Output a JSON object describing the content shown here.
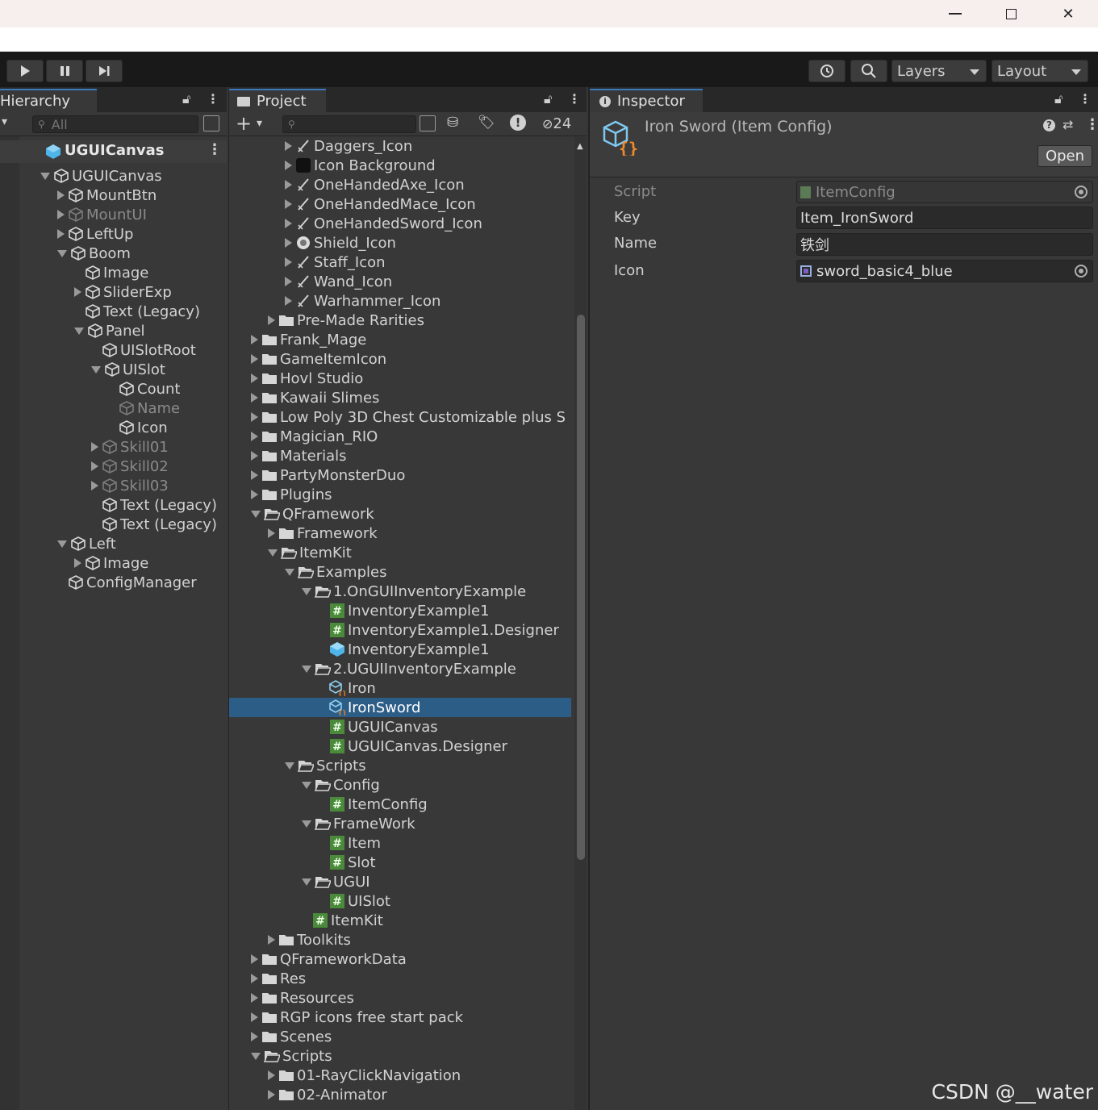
{
  "window": {
    "minimize_icon": "minimize-icon",
    "restore_icon": "restore-icon",
    "close_icon": "close-icon"
  },
  "toolbar": {
    "layers_label": "Layers",
    "layout_label": "Layout"
  },
  "hierarchy": {
    "tab_label": "Hierarchy",
    "search_placeholder": "All",
    "scene_name": "UGUICanvas",
    "items": [
      {
        "label": "UGUICanvas",
        "indent": 0,
        "arrow": "down",
        "dim": false
      },
      {
        "label": "MountBtn",
        "indent": 1,
        "arrow": "right",
        "dim": false
      },
      {
        "label": "MountUI",
        "indent": 1,
        "arrow": "right",
        "dim": true
      },
      {
        "label": "LeftUp",
        "indent": 1,
        "arrow": "right",
        "dim": false
      },
      {
        "label": "Boom",
        "indent": 1,
        "arrow": "down",
        "dim": false
      },
      {
        "label": "Image",
        "indent": 2,
        "arrow": "none",
        "dim": false
      },
      {
        "label": "SliderExp",
        "indent": 2,
        "arrow": "right",
        "dim": false
      },
      {
        "label": "Text (Legacy)",
        "indent": 2,
        "arrow": "none",
        "dim": false
      },
      {
        "label": "Panel",
        "indent": 2,
        "arrow": "down",
        "dim": false
      },
      {
        "label": "UISlotRoot",
        "indent": 3,
        "arrow": "none",
        "dim": false
      },
      {
        "label": "UISlot",
        "indent": 3,
        "arrow": "down",
        "dim": false
      },
      {
        "label": "Count",
        "indent": 4,
        "arrow": "none",
        "dim": false
      },
      {
        "label": "Name",
        "indent": 4,
        "arrow": "none",
        "dim": true
      },
      {
        "label": "Icon",
        "indent": 4,
        "arrow": "none",
        "dim": false
      },
      {
        "label": "Skill01",
        "indent": 3,
        "arrow": "right",
        "dim": true
      },
      {
        "label": "Skill02",
        "indent": 3,
        "arrow": "right",
        "dim": true
      },
      {
        "label": "Skill03",
        "indent": 3,
        "arrow": "right",
        "dim": true
      },
      {
        "label": "Text (Legacy)",
        "indent": 3,
        "arrow": "none",
        "dim": false
      },
      {
        "label": "Text (Legacy)",
        "indent": 3,
        "arrow": "none",
        "dim": false
      },
      {
        "label": "Left",
        "indent": 1,
        "arrow": "down",
        "dim": false
      },
      {
        "label": "Image",
        "indent": 2,
        "arrow": "right",
        "dim": false
      },
      {
        "label": "ConfigManager",
        "indent": 1,
        "arrow": "none",
        "dim": false
      }
    ]
  },
  "project": {
    "tab_label": "Project",
    "hidden_count": "24",
    "items": [
      {
        "label": "Daggers_Icon",
        "indent": 3,
        "arrow": "right",
        "icon": "sprite"
      },
      {
        "label": "Icon Background",
        "indent": 3,
        "arrow": "right",
        "icon": "dark-square"
      },
      {
        "label": "OneHandedAxe_Icon",
        "indent": 3,
        "arrow": "right",
        "icon": "sprite"
      },
      {
        "label": "OneHandedMace_Icon",
        "indent": 3,
        "arrow": "right",
        "icon": "sprite"
      },
      {
        "label": "OneHandedSword_Icon",
        "indent": 3,
        "arrow": "right",
        "icon": "sprite"
      },
      {
        "label": "Shield_Icon",
        "indent": 3,
        "arrow": "right",
        "icon": "shield"
      },
      {
        "label": "Staff_Icon",
        "indent": 3,
        "arrow": "right",
        "icon": "sprite"
      },
      {
        "label": "Wand_Icon",
        "indent": 3,
        "arrow": "right",
        "icon": "sprite"
      },
      {
        "label": "Warhammer_Icon",
        "indent": 3,
        "arrow": "right",
        "icon": "sprite"
      },
      {
        "label": "Pre-Made Rarities",
        "indent": 2,
        "arrow": "right",
        "icon": "folder"
      },
      {
        "label": "Frank_Mage",
        "indent": 1,
        "arrow": "right",
        "icon": "folder"
      },
      {
        "label": "GameItemIcon",
        "indent": 1,
        "arrow": "right",
        "icon": "folder"
      },
      {
        "label": "Hovl Studio",
        "indent": 1,
        "arrow": "right",
        "icon": "folder"
      },
      {
        "label": "Kawaii Slimes",
        "indent": 1,
        "arrow": "right",
        "icon": "folder"
      },
      {
        "label": "Low Poly 3D Chest Customizable plus S",
        "indent": 1,
        "arrow": "right",
        "icon": "folder"
      },
      {
        "label": "Magician_RIO",
        "indent": 1,
        "arrow": "right",
        "icon": "folder"
      },
      {
        "label": "Materials",
        "indent": 1,
        "arrow": "right",
        "icon": "folder"
      },
      {
        "label": "PartyMonsterDuo",
        "indent": 1,
        "arrow": "right",
        "icon": "folder"
      },
      {
        "label": "Plugins",
        "indent": 1,
        "arrow": "right",
        "icon": "folder"
      },
      {
        "label": "QFramework",
        "indent": 1,
        "arrow": "down",
        "icon": "folder-open"
      },
      {
        "label": "Framework",
        "indent": 2,
        "arrow": "right",
        "icon": "folder"
      },
      {
        "label": "ItemKit",
        "indent": 2,
        "arrow": "down",
        "icon": "folder-open"
      },
      {
        "label": "Examples",
        "indent": 3,
        "arrow": "down",
        "icon": "folder-open"
      },
      {
        "label": "1.OnGUIInventoryExample",
        "indent": 4,
        "arrow": "down",
        "icon": "folder-open"
      },
      {
        "label": "InventoryExample1",
        "indent": 5,
        "arrow": "none",
        "icon": "script"
      },
      {
        "label": "InventoryExample1.Designer",
        "indent": 5,
        "arrow": "none",
        "icon": "script"
      },
      {
        "label": "InventoryExample1",
        "indent": 5,
        "arrow": "none",
        "icon": "prefab"
      },
      {
        "label": "2.UGUIInventoryExample",
        "indent": 4,
        "arrow": "down",
        "icon": "folder-open"
      },
      {
        "label": "Iron",
        "indent": 5,
        "arrow": "none",
        "icon": "config"
      },
      {
        "label": "IronSword",
        "indent": 5,
        "arrow": "none",
        "icon": "config",
        "selected": true
      },
      {
        "label": "UGUICanvas",
        "indent": 5,
        "arrow": "none",
        "icon": "script"
      },
      {
        "label": "UGUICanvas.Designer",
        "indent": 5,
        "arrow": "none",
        "icon": "script"
      },
      {
        "label": "Scripts",
        "indent": 3,
        "arrow": "down",
        "icon": "folder-open"
      },
      {
        "label": "Config",
        "indent": 4,
        "arrow": "down",
        "icon": "folder-open"
      },
      {
        "label": "ItemConfig",
        "indent": 5,
        "arrow": "none",
        "icon": "script"
      },
      {
        "label": "FrameWork",
        "indent": 4,
        "arrow": "down",
        "icon": "folder-open"
      },
      {
        "label": "Item",
        "indent": 5,
        "arrow": "none",
        "icon": "script"
      },
      {
        "label": "Slot",
        "indent": 5,
        "arrow": "none",
        "icon": "script"
      },
      {
        "label": "UGUI",
        "indent": 4,
        "arrow": "down",
        "icon": "folder-open"
      },
      {
        "label": "UISlot",
        "indent": 5,
        "arrow": "none",
        "icon": "script"
      },
      {
        "label": "ItemKit",
        "indent": 4,
        "arrow": "none",
        "icon": "script"
      },
      {
        "label": "Toolkits",
        "indent": 2,
        "arrow": "right",
        "icon": "folder"
      },
      {
        "label": "QFrameworkData",
        "indent": 1,
        "arrow": "right",
        "icon": "folder"
      },
      {
        "label": "Res",
        "indent": 1,
        "arrow": "right",
        "icon": "folder"
      },
      {
        "label": "Resources",
        "indent": 1,
        "arrow": "right",
        "icon": "folder"
      },
      {
        "label": "RGP icons free start pack",
        "indent": 1,
        "arrow": "right",
        "icon": "folder"
      },
      {
        "label": "Scenes",
        "indent": 1,
        "arrow": "right",
        "icon": "folder"
      },
      {
        "label": "Scripts",
        "indent": 1,
        "arrow": "down",
        "icon": "folder-open"
      },
      {
        "label": "01-RayClickNavigation",
        "indent": 2,
        "arrow": "right",
        "icon": "folder"
      },
      {
        "label": "02-Animator",
        "indent": 2,
        "arrow": "right",
        "icon": "folder"
      }
    ]
  },
  "inspector": {
    "tab_label": "Inspector",
    "asset_title": "Iron Sword (Item Config)",
    "open_label": "Open",
    "fields": {
      "script_label": "Script",
      "script_value": "ItemConfig",
      "key_label": "Key",
      "key_value": "Item_IronSword",
      "name_label": "Name",
      "name_value": "铁剑",
      "icon_label": "Icon",
      "icon_value": "sword_basic4_blue"
    }
  },
  "watermark": "CSDN @__water",
  "colors": {
    "selection": "#2c5d87",
    "tab_accent": "#3a79bb",
    "panel_bg": "#383838",
    "header_bg": "#282828",
    "toolbar_bg": "#191919",
    "title_bar": "#f7eeee"
  }
}
